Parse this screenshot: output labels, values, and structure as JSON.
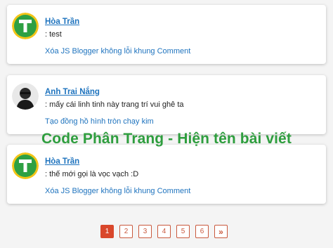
{
  "comments": [
    {
      "author": "Hòa Trần",
      "text": ": test",
      "post_link": "Xóa JS Blogger không lỗi khung Comment",
      "avatar_icon": "green-t-logo-icon"
    },
    {
      "author": "Anh Trai Nắng",
      "text": ": mấy cái linh tinh này trang trí vui ghê ta",
      "post_link": "Tạo đồng hồ hình tròn chạy kim",
      "avatar_icon": "user-photo-avatar"
    },
    {
      "author": "Hòa Trần",
      "text": ": thế mới gọi là vọc vạch :D",
      "post_link": "Xóa JS Blogger không lỗi khung Comment",
      "avatar_icon": "green-t-logo-icon"
    }
  ],
  "overlay_title": "Code Phân Trang - Hiện tên bài viết",
  "pagination": {
    "pages": [
      "1",
      "2",
      "3",
      "4",
      "5",
      "6"
    ],
    "active": "1",
    "next_label": "»"
  },
  "colors": {
    "link": "#1e73be",
    "overlay": "#2e9e3e",
    "active_page": "#d9472b",
    "logo_green": "#2ea043"
  }
}
